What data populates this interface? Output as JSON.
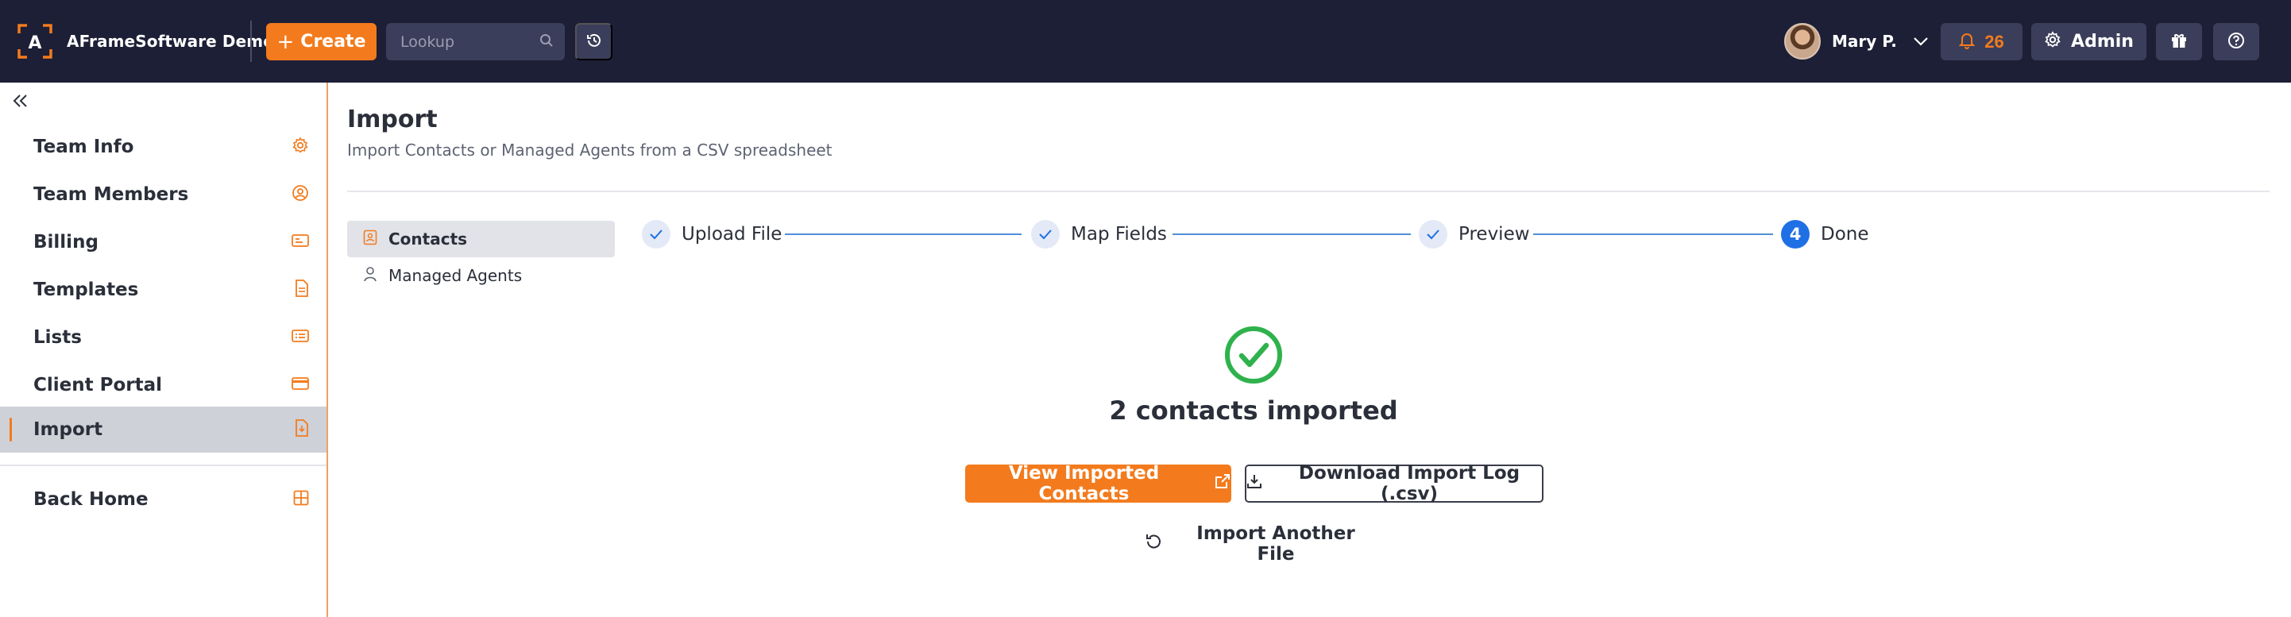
{
  "header": {
    "brand_name": "AFrameSoftware Demo",
    "logo_letter": "A",
    "create_label": "Create",
    "lookup_placeholder": "Lookup",
    "user_name": "Mary P.",
    "notification_count": "26",
    "admin_label": "Admin"
  },
  "sidebar": {
    "items": [
      {
        "label": "Team Info",
        "icon": "gear-icon"
      },
      {
        "label": "Team Members",
        "icon": "user-circle-icon"
      },
      {
        "label": "Billing",
        "icon": "billing-card-icon"
      },
      {
        "label": "Templates",
        "icon": "document-icon"
      },
      {
        "label": "Lists",
        "icon": "list-icon"
      },
      {
        "label": "Client Portal",
        "icon": "portal-card-icon"
      },
      {
        "label": "Import",
        "icon": "import-file-icon",
        "active": true
      }
    ],
    "back_home_label": "Back Home",
    "back_home_icon": "grid-icon"
  },
  "main": {
    "title": "Import",
    "subtitle": "Import Contacts or Managed Agents from a CSV spreadsheet",
    "sub_nav": [
      {
        "label": "Contacts",
        "active": true,
        "icon": "contacts-icon"
      },
      {
        "label": "Managed Agents",
        "active": false,
        "icon": "person-icon"
      }
    ],
    "steps": [
      {
        "label": "Upload File",
        "status": "complete"
      },
      {
        "label": "Map Fields",
        "status": "complete"
      },
      {
        "label": "Preview",
        "status": "complete"
      },
      {
        "label": "Done",
        "status": "current",
        "number": "4"
      }
    ],
    "result_text": "2 contacts imported",
    "view_button": "View Imported Contacts",
    "download_button": "Download Import Log (.csv)",
    "another_button": "Import Another File"
  },
  "colors": {
    "accent": "#f37b1d",
    "topbar": "#1d1f36",
    "step_current": "#1f6fe5",
    "success": "#2fb24c"
  }
}
